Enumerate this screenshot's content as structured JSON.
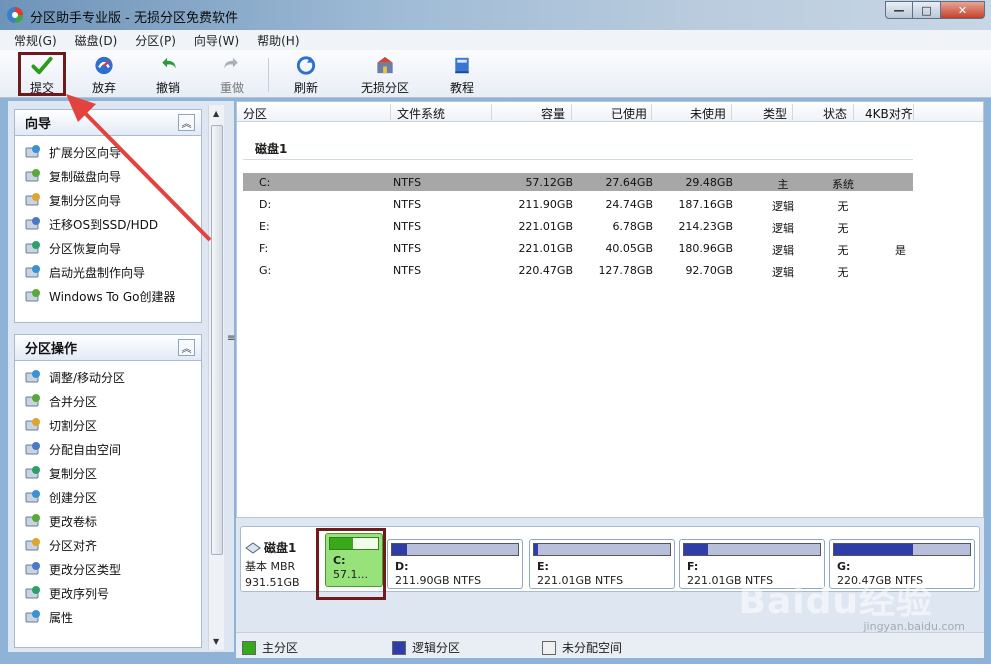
{
  "window": {
    "title": "分区助手专业版 - 无损分区免费软件",
    "minimize": "—",
    "maximize": "□",
    "close": "✕"
  },
  "menu": [
    "常规(G)",
    "磁盘(D)",
    "分区(P)",
    "向导(W)",
    "帮助(H)"
  ],
  "toolbar": {
    "submit": "提交",
    "discard": "放弃",
    "undo": "撤销",
    "redo": "重做",
    "refresh": "刷新",
    "lossless": "无损分区",
    "tutorial": "教程"
  },
  "wizard_panel": {
    "title": "向导",
    "items": [
      {
        "label": "扩展分区向导",
        "icon": "extend-partition-icon"
      },
      {
        "label": "复制磁盘向导",
        "icon": "copy-disk-icon"
      },
      {
        "label": "复制分区向导",
        "icon": "copy-partition-icon"
      },
      {
        "label": "迁移OS到SSD/HDD",
        "icon": "migrate-os-icon"
      },
      {
        "label": "分区恢复向导",
        "icon": "partition-recovery-icon"
      },
      {
        "label": "启动光盘制作向导",
        "icon": "bootable-disc-icon"
      },
      {
        "label": "Windows To Go创建器",
        "icon": "windows-to-go-icon"
      }
    ]
  },
  "partition_panel": {
    "title": "分区操作",
    "items": [
      {
        "label": "调整/移动分区",
        "icon": "resize-move-icon"
      },
      {
        "label": "合并分区",
        "icon": "merge-icon"
      },
      {
        "label": "切割分区",
        "icon": "split-icon"
      },
      {
        "label": "分配自由空间",
        "icon": "allocate-space-icon"
      },
      {
        "label": "复制分区",
        "icon": "copy-icon"
      },
      {
        "label": "创建分区",
        "icon": "create-icon"
      },
      {
        "label": "更改卷标",
        "icon": "label-icon"
      },
      {
        "label": "分区对齐",
        "icon": "align-icon"
      },
      {
        "label": "更改分区类型",
        "icon": "change-type-icon"
      },
      {
        "label": "更改序列号",
        "icon": "serial-icon"
      },
      {
        "label": "属性",
        "icon": "info-icon"
      }
    ]
  },
  "table": {
    "headers": [
      "分区",
      "文件系统",
      "容量",
      "已使用",
      "未使用",
      "类型",
      "状态",
      "4KB对齐"
    ],
    "disk_title": "磁盘1",
    "rows": [
      {
        "partition": "C:",
        "fs": "NTFS",
        "capacity": "57.12GB",
        "used": "27.64GB",
        "free": "29.48GB",
        "type": "主",
        "status": "系统",
        "align": ""
      },
      {
        "partition": "D:",
        "fs": "NTFS",
        "capacity": "211.90GB",
        "used": "24.74GB",
        "free": "187.16GB",
        "type": "逻辑",
        "status": "无",
        "align": ""
      },
      {
        "partition": "E:",
        "fs": "NTFS",
        "capacity": "221.01GB",
        "used": "6.78GB",
        "free": "214.23GB",
        "type": "逻辑",
        "status": "无",
        "align": ""
      },
      {
        "partition": "F:",
        "fs": "NTFS",
        "capacity": "221.01GB",
        "used": "40.05GB",
        "free": "180.96GB",
        "type": "逻辑",
        "status": "无",
        "align": "是"
      },
      {
        "partition": "G:",
        "fs": "NTFS",
        "capacity": "220.47GB",
        "used": "127.78GB",
        "free": "92.70GB",
        "type": "逻辑",
        "status": "无",
        "align": ""
      }
    ]
  },
  "diskmap": {
    "disk_name": "磁盘1",
    "disk_type": "基本 MBR",
    "disk_size": "931.51GB",
    "partitions": [
      {
        "label": "C:",
        "desc": "57.1...",
        "kind": "primary",
        "used_ratio": 0.48
      },
      {
        "label": "D:",
        "desc": "211.90GB NTFS",
        "kind": "logical",
        "used_ratio": 0.12
      },
      {
        "label": "E:",
        "desc": "221.01GB NTFS",
        "kind": "logical",
        "used_ratio": 0.03
      },
      {
        "label": "F:",
        "desc": "221.01GB NTFS",
        "kind": "logical",
        "used_ratio": 0.18
      },
      {
        "label": "G:",
        "desc": "220.47GB NTFS",
        "kind": "logical",
        "used_ratio": 0.58
      }
    ]
  },
  "legend": {
    "primary": "主分区",
    "logical": "逻辑分区",
    "unallocated": "未分配空间"
  },
  "watermark": {
    "brand": "Baidu经验",
    "url": "jingyan.baidu.com"
  },
  "colors": {
    "primary_green": "#37a91b",
    "logical_blue": "#2f3da8",
    "highlight_red": "#6e1b1b",
    "annotation_arrow": "#e2433f"
  }
}
